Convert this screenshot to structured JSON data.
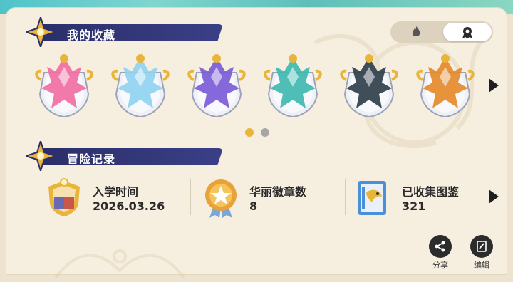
{
  "collection": {
    "title": "我的收藏",
    "toggle": {
      "left_icon": "fire-egg-icon",
      "right_icon": "badge-icon",
      "selected": "right"
    },
    "badges": [
      {
        "name": "pink-flower-badge",
        "color": "#f06fa3"
      },
      {
        "name": "ice-crystal-badge",
        "color": "#8fd3f0"
      },
      {
        "name": "purple-cat-badge",
        "color": "#7b5bd6"
      },
      {
        "name": "teal-dragon-badge",
        "color": "#3fb8b0"
      },
      {
        "name": "dark-beast-badge",
        "color": "#2f3f4a"
      },
      {
        "name": "golden-bird-badge",
        "color": "#e58a2b"
      }
    ],
    "page_count": 2,
    "current_page": 1
  },
  "adventure": {
    "title": "冒险记录",
    "stats": [
      {
        "label": "入学时间",
        "value": "2026.03.26",
        "icon": "school-crest-icon"
      },
      {
        "label": "华丽徽章数",
        "value": "8",
        "icon": "star-medal-icon"
      },
      {
        "label": "已收集图鉴",
        "value": "321",
        "icon": "book-icon"
      }
    ]
  },
  "actions": {
    "share": "分享",
    "edit": "编辑"
  },
  "colors": {
    "header": "#2a2f6b",
    "panel": "#f6efe0",
    "accent_gold": "#e9b43a",
    "dot_inactive": "#a6a6a6"
  }
}
